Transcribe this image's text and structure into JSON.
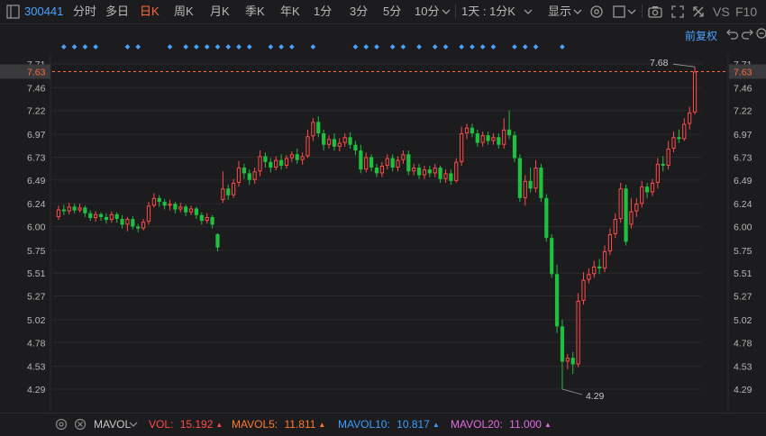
{
  "toolbar": {
    "stock_code": "300441",
    "periods": [
      {
        "label": "分时",
        "active": false
      },
      {
        "label": "多日",
        "active": false
      },
      {
        "label": "日K",
        "active": true
      },
      {
        "label": "周K",
        "active": false
      },
      {
        "label": "月K",
        "active": false
      },
      {
        "label": "季K",
        "active": false
      },
      {
        "label": "年K",
        "active": false
      },
      {
        "label": "1分",
        "active": false
      },
      {
        "label": "3分",
        "active": false
      },
      {
        "label": "5分",
        "active": false
      },
      {
        "label": "10分",
        "active": false
      },
      {
        "label": "1天 : 1分K",
        "active": false
      }
    ],
    "display_label": "显示",
    "vs_label": "VS",
    "f10_label": "F10",
    "fuquan_label": "前复权",
    "icons": [
      "panel-toggle-icon",
      "chevron-down-icon",
      "gear-icon",
      "checkbox-icon",
      "camera-icon",
      "fullscreen-icon",
      "undo-icon",
      "redo-icon",
      "zoom-out-icon",
      "zoom-in-icon",
      "more-icon"
    ]
  },
  "colors": {
    "up": "#ff4a4a",
    "down": "#1fbf3f",
    "marker": "#4aa2ff",
    "price_line": "#ff6a3a",
    "grid": "#2a2a2c",
    "axis_text": "#b8b8b8"
  },
  "chart_data": {
    "type": "candlestick",
    "ylim": [
      4.2,
      7.74
    ],
    "y_ticks": [
      "7.71",
      "7.46",
      "7.22",
      "6.97",
      "6.73",
      "6.49",
      "6.24",
      "6.00",
      "5.75",
      "5.51",
      "5.27",
      "5.02",
      "4.78",
      "4.53",
      "4.29"
    ],
    "current_price": "7.63",
    "high_label": "7.68",
    "low_label": "4.29",
    "markers": [
      1,
      3,
      5,
      7,
      13,
      15,
      21,
      24,
      26,
      28,
      30,
      32,
      34,
      36,
      40,
      42,
      44,
      48,
      56,
      58,
      60,
      63,
      65,
      68,
      71,
      73,
      76,
      78,
      80,
      82,
      86,
      88,
      90,
      95
    ],
    "candles": [
      [
        6.1,
        6.18,
        6.22,
        6.07
      ],
      [
        6.18,
        6.16,
        6.23,
        6.12
      ],
      [
        6.16,
        6.21,
        6.25,
        6.13
      ],
      [
        6.21,
        6.17,
        6.24,
        6.14
      ],
      [
        6.17,
        6.2,
        6.24,
        6.15
      ],
      [
        6.2,
        6.14,
        6.22,
        6.1
      ],
      [
        6.14,
        6.09,
        6.17,
        6.06
      ],
      [
        6.09,
        6.13,
        6.16,
        6.05
      ],
      [
        6.13,
        6.1,
        6.15,
        6.06
      ],
      [
        6.1,
        6.07,
        6.14,
        6.03
      ],
      [
        6.07,
        6.13,
        6.16,
        6.04
      ],
      [
        6.13,
        6.08,
        6.15,
        6.04
      ],
      [
        6.08,
        6.02,
        6.12,
        5.98
      ],
      [
        6.02,
        6.08,
        6.1,
        5.95
      ],
      [
        6.08,
        6.0,
        6.11,
        5.97
      ],
      [
        6.0,
        5.98,
        6.03,
        5.94
      ],
      [
        5.98,
        6.05,
        6.08,
        5.96
      ],
      [
        6.05,
        6.22,
        6.26,
        6.02
      ],
      [
        6.22,
        6.3,
        6.35,
        6.2
      ],
      [
        6.3,
        6.26,
        6.33,
        6.21
      ],
      [
        6.26,
        6.22,
        6.29,
        6.18
      ],
      [
        6.22,
        6.24,
        6.28,
        6.17
      ],
      [
        6.24,
        6.18,
        6.26,
        6.14
      ],
      [
        6.18,
        6.21,
        6.25,
        6.15
      ],
      [
        6.21,
        6.15,
        6.23,
        6.11
      ],
      [
        6.15,
        6.19,
        6.22,
        6.12
      ],
      [
        6.19,
        6.12,
        6.21,
        6.08
      ],
      [
        6.12,
        6.06,
        6.15,
        6.02
      ],
      [
        6.06,
        6.1,
        6.14,
        6.03
      ],
      [
        6.1,
        6.02,
        6.12,
        5.98
      ],
      [
        5.92,
        5.78,
        5.93,
        5.74
      ],
      [
        6.28,
        6.4,
        6.58,
        6.25
      ],
      [
        6.4,
        6.33,
        6.44,
        6.28
      ],
      [
        6.33,
        6.46,
        6.5,
        6.3
      ],
      [
        6.46,
        6.62,
        6.69,
        6.42
      ],
      [
        6.62,
        6.56,
        6.66,
        6.5
      ],
      [
        6.56,
        6.49,
        6.6,
        6.44
      ],
      [
        6.49,
        6.58,
        6.62,
        6.45
      ],
      [
        6.58,
        6.74,
        6.8,
        6.53
      ],
      [
        6.74,
        6.68,
        6.78,
        6.62
      ],
      [
        6.68,
        6.62,
        6.72,
        6.57
      ],
      [
        6.62,
        6.7,
        6.74,
        6.59
      ],
      [
        6.7,
        6.64,
        6.76,
        6.6
      ],
      [
        6.64,
        6.72,
        6.75,
        6.61
      ],
      [
        6.72,
        6.76,
        6.79,
        6.68
      ],
      [
        6.76,
        6.7,
        6.82,
        6.66
      ],
      [
        6.7,
        6.74,
        6.78,
        6.65
      ],
      [
        6.74,
        6.95,
        7.02,
        6.72
      ],
      [
        6.95,
        7.1,
        7.14,
        6.9
      ],
      [
        7.1,
        6.98,
        7.16,
        6.94
      ],
      [
        6.98,
        6.86,
        7.02,
        6.8
      ],
      [
        6.86,
        6.92,
        6.96,
        6.82
      ],
      [
        6.92,
        6.84,
        6.98,
        6.8
      ],
      [
        6.84,
        6.88,
        6.93,
        6.79
      ],
      [
        6.88,
        6.94,
        6.98,
        6.84
      ],
      [
        6.94,
        6.86,
        6.99,
        6.82
      ],
      [
        6.86,
        6.8,
        6.9,
        6.75
      ],
      [
        6.8,
        6.6,
        6.86,
        6.56
      ],
      [
        6.6,
        6.73,
        6.78,
        6.57
      ],
      [
        6.73,
        6.62,
        6.76,
        6.58
      ],
      [
        6.62,
        6.56,
        6.66,
        6.52
      ],
      [
        6.56,
        6.64,
        6.68,
        6.52
      ],
      [
        6.64,
        6.72,
        6.76,
        6.6
      ],
      [
        6.72,
        6.62,
        6.76,
        6.58
      ],
      [
        6.62,
        6.7,
        6.74,
        6.58
      ],
      [
        6.7,
        6.76,
        6.8,
        6.66
      ],
      [
        6.76,
        6.58,
        6.8,
        6.54
      ],
      [
        6.58,
        6.62,
        6.66,
        6.54
      ],
      [
        6.62,
        6.54,
        6.66,
        6.5
      ],
      [
        6.54,
        6.6,
        6.64,
        6.5
      ],
      [
        6.6,
        6.56,
        6.64,
        6.52
      ],
      [
        6.56,
        6.62,
        6.66,
        6.52
      ],
      [
        6.62,
        6.5,
        6.64,
        6.46
      ],
      [
        6.5,
        6.56,
        6.6,
        6.46
      ],
      [
        6.56,
        6.48,
        6.6,
        6.44
      ],
      [
        6.48,
        6.68,
        6.72,
        6.46
      ],
      [
        6.68,
        6.98,
        7.05,
        6.64
      ],
      [
        6.98,
        7.04,
        7.08,
        6.92
      ],
      [
        7.04,
        6.98,
        7.08,
        6.94
      ],
      [
        6.98,
        6.88,
        7.02,
        6.84
      ],
      [
        6.88,
        6.96,
        7.0,
        6.84
      ],
      [
        6.96,
        6.9,
        7.0,
        6.86
      ],
      [
        6.9,
        6.94,
        6.98,
        6.86
      ],
      [
        6.94,
        6.86,
        6.98,
        6.82
      ],
      [
        6.86,
        7.02,
        7.14,
        6.82
      ],
      [
        7.02,
        6.96,
        7.22,
        6.92
      ],
      [
        6.96,
        6.72,
        7.0,
        6.68
      ],
      [
        6.72,
        6.3,
        6.76,
        6.26
      ],
      [
        6.3,
        6.48,
        6.54,
        6.22
      ],
      [
        6.48,
        6.4,
        6.62,
        6.36
      ],
      [
        6.4,
        6.62,
        6.7,
        6.36
      ],
      [
        6.62,
        6.3,
        6.66,
        6.26
      ],
      [
        6.3,
        5.88,
        6.34,
        5.84
      ],
      [
        5.88,
        5.5,
        5.92,
        5.46
      ],
      [
        5.5,
        4.95,
        5.6,
        4.88
      ],
      [
        4.95,
        4.58,
        5.02,
        4.29
      ],
      [
        4.58,
        4.62,
        4.66,
        4.5
      ],
      [
        4.62,
        4.55,
        4.68,
        4.45
      ],
      [
        4.55,
        5.22,
        5.3,
        4.52
      ],
      [
        5.22,
        5.44,
        5.52,
        5.18
      ],
      [
        5.44,
        5.5,
        5.56,
        5.4
      ],
      [
        5.5,
        5.58,
        5.64,
        5.46
      ],
      [
        5.58,
        5.56,
        5.66,
        5.5
      ],
      [
        5.56,
        5.74,
        5.8,
        5.52
      ],
      [
        5.74,
        5.92,
        5.98,
        5.7
      ],
      [
        5.92,
        6.08,
        6.14,
        5.88
      ],
      [
        6.08,
        6.4,
        6.46,
        6.04
      ],
      [
        6.4,
        5.84,
        6.44,
        5.8
      ],
      [
        6.02,
        6.16,
        6.3,
        5.98
      ],
      [
        6.16,
        6.24,
        6.3,
        6.1
      ],
      [
        6.24,
        6.42,
        6.48,
        6.2
      ],
      [
        6.42,
        6.36,
        6.46,
        6.3
      ],
      [
        6.36,
        6.46,
        6.5,
        6.32
      ],
      [
        6.46,
        6.66,
        6.72,
        6.4
      ],
      [
        6.66,
        6.64,
        6.74,
        6.58
      ],
      [
        6.64,
        6.82,
        6.9,
        6.6
      ],
      [
        6.82,
        6.94,
        7.0,
        6.78
      ],
      [
        6.94,
        6.92,
        7.02,
        6.88
      ],
      [
        6.92,
        7.08,
        7.14,
        6.9
      ],
      [
        7.08,
        7.2,
        7.26,
        7.02
      ],
      [
        7.2,
        7.63,
        7.68,
        7.18
      ]
    ]
  },
  "bottombar": {
    "indicator_name": "MAVOL",
    "items": [
      {
        "label": "VOL:",
        "value": "15.192",
        "color": "#ff4a4a"
      },
      {
        "label": "MAVOL5:",
        "value": "11.811",
        "color": "#ff7a2e"
      },
      {
        "label": "MAVOL10:",
        "value": "10.817",
        "color": "#3a9eff"
      },
      {
        "label": "MAVOL20:",
        "value": "11.000",
        "color": "#e36ae3"
      }
    ]
  }
}
